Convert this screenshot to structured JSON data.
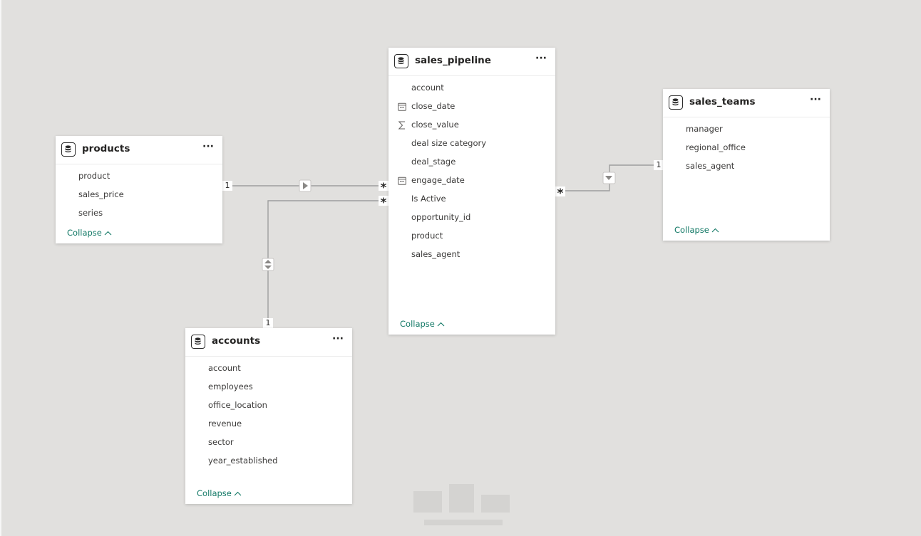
{
  "tables": {
    "sales_pipeline": {
      "title": "sales_pipeline",
      "fields": [
        {
          "name": "account",
          "icon": ""
        },
        {
          "name": "close_date",
          "icon": "calendar-icon"
        },
        {
          "name": "close_value",
          "icon": "sigma-icon"
        },
        {
          "name": "deal size category",
          "icon": ""
        },
        {
          "name": "deal_stage",
          "icon": ""
        },
        {
          "name": "engage_date",
          "icon": "calendar-icon"
        },
        {
          "name": "Is Active",
          "icon": ""
        },
        {
          "name": "opportunity_id",
          "icon": ""
        },
        {
          "name": "product",
          "icon": ""
        },
        {
          "name": "sales_agent",
          "icon": ""
        }
      ],
      "collapse_label": "Collapse"
    },
    "products": {
      "title": "products",
      "fields": [
        {
          "name": "product",
          "icon": ""
        },
        {
          "name": "sales_price",
          "icon": ""
        },
        {
          "name": "series",
          "icon": ""
        }
      ],
      "collapse_label": "Collapse"
    },
    "sales_teams": {
      "title": "sales_teams",
      "fields": [
        {
          "name": "manager",
          "icon": ""
        },
        {
          "name": "regional_office",
          "icon": ""
        },
        {
          "name": "sales_agent",
          "icon": ""
        }
      ],
      "collapse_label": "Collapse"
    },
    "accounts": {
      "title": "accounts",
      "fields": [
        {
          "name": "account",
          "icon": ""
        },
        {
          "name": "employees",
          "icon": ""
        },
        {
          "name": "office_location",
          "icon": ""
        },
        {
          "name": "revenue",
          "icon": ""
        },
        {
          "name": "sector",
          "icon": ""
        },
        {
          "name": "year_established",
          "icon": ""
        }
      ],
      "collapse_label": "Collapse"
    }
  },
  "relationships": [
    {
      "from": "products",
      "to": "sales_pipeline",
      "from_cardinality": "1",
      "to_cardinality": "*",
      "filter_direction": "single"
    },
    {
      "from": "accounts",
      "to": "sales_pipeline",
      "from_cardinality": "1",
      "to_cardinality": "*",
      "filter_direction": "both"
    },
    {
      "from": "sales_teams",
      "to": "sales_pipeline",
      "from_cardinality": "1",
      "to_cardinality": "*",
      "filter_direction": "single"
    }
  ],
  "ui": {
    "more_icon": "more-options-icon",
    "table_icon": "table-icon",
    "collapse_chevron": "^",
    "colors": {
      "canvas": "#e1e0de",
      "card": "#ffffff",
      "line": "#9e9e9e",
      "collapse_text": "#117865",
      "text": "#3b3a39"
    }
  }
}
